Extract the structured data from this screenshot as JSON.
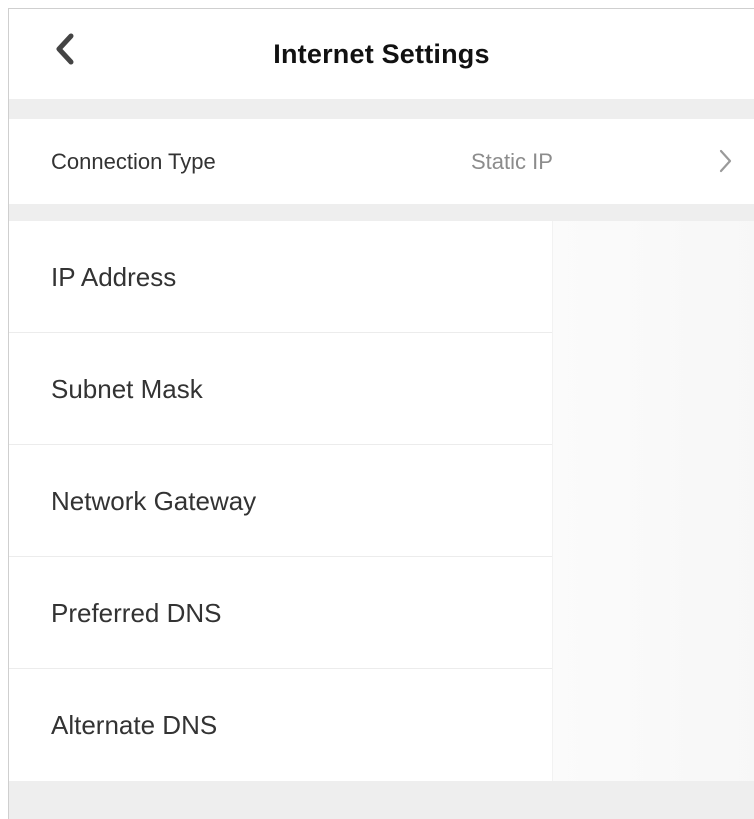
{
  "header": {
    "title": "Internet Settings",
    "back_icon": "chevron-left-icon"
  },
  "connection": {
    "label": "Connection Type",
    "value": "Static IP",
    "chevron_icon": "chevron-right-icon"
  },
  "fields": [
    {
      "label": "IP Address"
    },
    {
      "label": "Subnet Mask"
    },
    {
      "label": "Network Gateway"
    },
    {
      "label": "Preferred DNS"
    },
    {
      "label": "Alternate DNS"
    }
  ],
  "colors": {
    "background": "#f0f0f0",
    "surface": "#ffffff",
    "primary_text": "#333333",
    "secondary_text": "#8c8c8c"
  }
}
